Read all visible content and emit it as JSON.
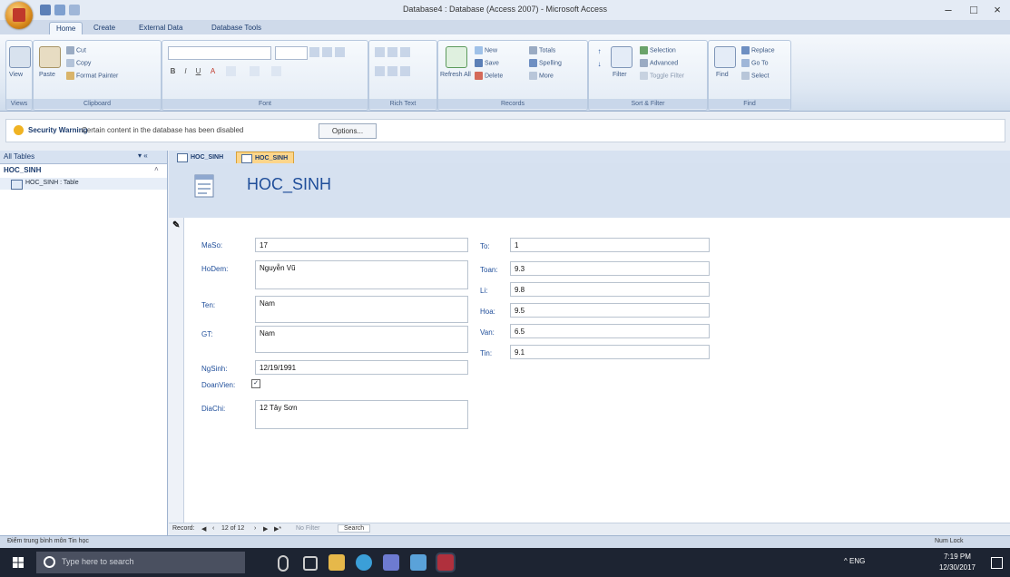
{
  "window": {
    "title": "Database4 : Database (Access 2007) - Microsoft Access",
    "controls": {
      "minimize": "–",
      "maximize": "□",
      "close": "×"
    }
  },
  "ribbon": {
    "tabs": [
      "Home",
      "Create",
      "External Data",
      "Database Tools"
    ],
    "active_tab": "Home",
    "groups": {
      "views": {
        "label": "Views",
        "buttons": [
          "View"
        ]
      },
      "clipboard": {
        "label": "Clipboard",
        "buttons": [
          "Paste",
          "Cut",
          "Copy",
          "Format Painter"
        ]
      },
      "font": {
        "label": "Font"
      },
      "rich_text": {
        "label": "Rich Text"
      },
      "records": {
        "label": "Records",
        "buttons": [
          "Refresh All",
          "New",
          "Save",
          "Delete",
          "Totals",
          "Spelling",
          "More"
        ]
      },
      "sort_filter": {
        "label": "Sort & Filter",
        "buttons": [
          "Filter",
          "Selection",
          "Advanced",
          "Toggle Filter"
        ]
      },
      "find": {
        "label": "Find",
        "buttons": [
          "Find",
          "Replace",
          "Go To",
          "Select"
        ]
      }
    }
  },
  "security_bar": {
    "title": "Security Warning",
    "message": "Certain content in the database has been disabled",
    "options_label": "Options..."
  },
  "nav_pane": {
    "header": "All Tables",
    "arrows": "▾ «",
    "group": "HOC_SINH",
    "items": [
      "HOC_SINH : Table"
    ]
  },
  "document": {
    "tabs": [
      "HOC_SINH",
      "HOC_SINH"
    ],
    "active_tab_index": 1,
    "form_title": "HOC_SINH",
    "fields_left": [
      {
        "label": "MaSo:",
        "value": "17"
      },
      {
        "label": "HoDem:",
        "value": "Nguyễn Vũ"
      },
      {
        "label": "Ten:",
        "value": "Nam"
      },
      {
        "label": "GT:",
        "value": "Nam"
      },
      {
        "label": "NgSinh:",
        "value": "12/19/1991"
      },
      {
        "label": "DoanVien:",
        "checked": true
      },
      {
        "label": "DiaChi:",
        "value": "12 Tây Sơn"
      }
    ],
    "fields_right": [
      {
        "label": "To:",
        "value": "1"
      },
      {
        "label": "Toan:",
        "value": "9.3"
      },
      {
        "label": "Li:",
        "value": "9.8"
      },
      {
        "label": "Hoa:",
        "value": "9.5"
      },
      {
        "label": "Van:",
        "value": "6.5"
      },
      {
        "label": "Tin:",
        "value": "9.1"
      }
    ]
  },
  "record_nav": {
    "label": "Record:",
    "position": "12 of 12",
    "filter": "No Filter",
    "search": "Search"
  },
  "status": {
    "left": "Điểm trung bình môn Tin học",
    "right": "Num Lock"
  },
  "taskbar": {
    "search_placeholder": "Type here to search",
    "tray": "^  ENG",
    "time": "7:19 PM",
    "date": "12/30/2017"
  }
}
